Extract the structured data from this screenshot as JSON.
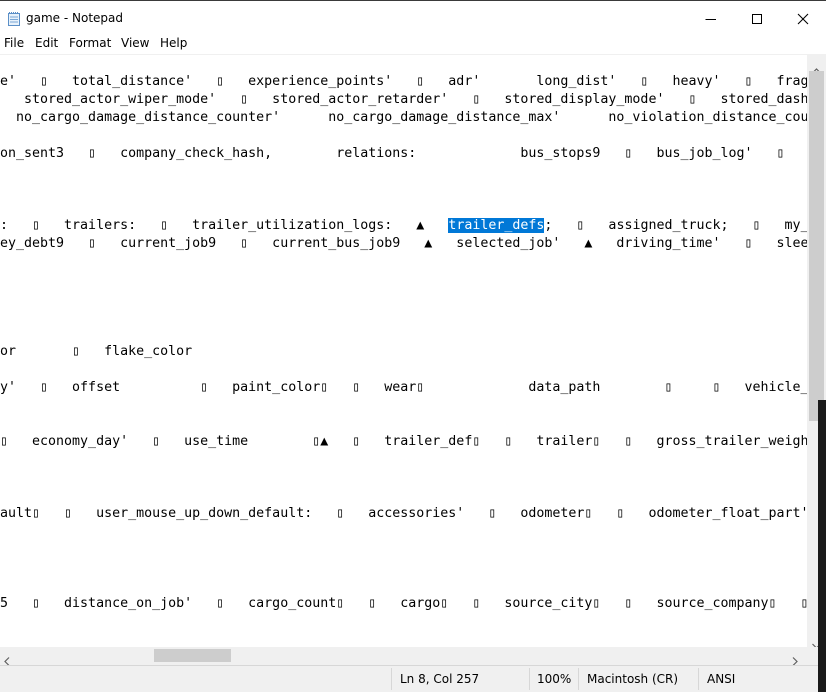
{
  "window": {
    "title": "game - Notepad",
    "icon": "notepad-icon",
    "controls": [
      "minimize-icon",
      "maximize-icon",
      "close-icon"
    ]
  },
  "menu": [
    "File",
    "Edit",
    "Format",
    "View",
    "Help"
  ],
  "editor": {
    "lines": [
      "e'   ▯   total_distance'   ▯   experience_points'   ▯   adr'       long_dist'   ▯   heavy'   ▯   fragile",
      "   stored_actor_wiper_mode'   ▯   stored_actor_retarder'   ▯   stored_display_mode'   ▯   stored_dashbo",
      "  no_cargo_damage_distance_counter'      no_cargo_damage_distance_max'      no_violation_distance_count",
      "",
      "on_sent3   ▯   company_check_hash,        relations:             bus_stops9   ▯   bus_job_log'   ▯",
      "",
      "",
      ":   ▯   trailers:   ▯   trailer_utilization_logs:   ▲   ",
      "ey_debt9   ▯   current_job9   ▯   current_bus_job9   ▲   selected_job'   ▲   driving_time'   ▯   sleep",
      "",
      "",
      "",
      "",
      "",
      "",
      "or       ▯   flake_color",
      "",
      "y'   ▯   offset          ▯   paint_color▯   ▯   wear▯             data_path        ▯     ▯   vehicle_",
      "",
      "",
      "▯   economy_day'   ▯   use_time        ▯▲   ▯   trailer_def▯   ▯   trailer▯   ▯   gross_trailer_weight_",
      "",
      "",
      "",
      "ault▯   ▯   user_mouse_up_down_default:   ▯   accessories'   ▯   odometer▯   ▯   odometer_float_part'",
      "",
      "",
      "",
      "",
      "5   ▯   distance_on_job'   ▯   cargo_count▯   ▯   cargo▯   ▯   source_city▯   ▯   source_company▯   ▯   de"
    ],
    "selected_text": "trailer_defs",
    "after_selection": ";   ▯   assigned_truck;   ▯   my_tr"
  },
  "status": {
    "position": "Ln 8, Col 257",
    "zoom": "100%",
    "line_ending": "Macintosh (CR)",
    "encoding": "ANSI"
  }
}
